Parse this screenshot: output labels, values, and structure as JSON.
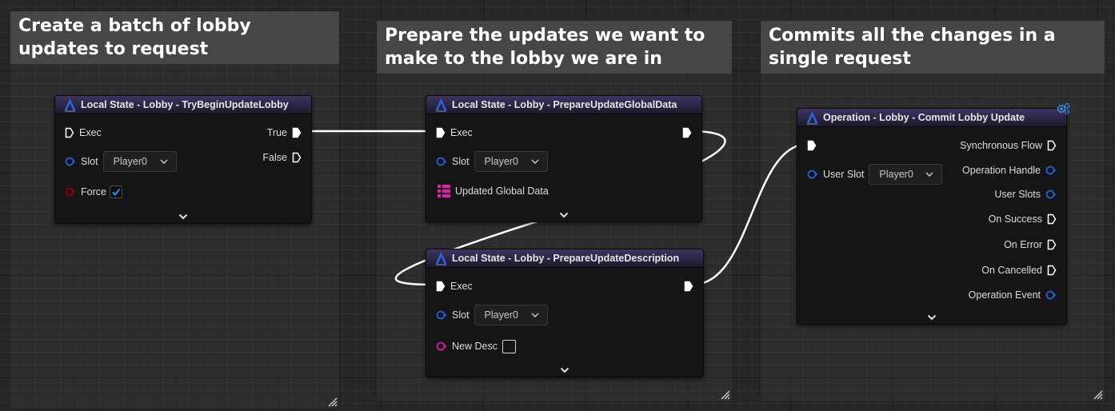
{
  "comments": [
    {
      "title": "Create a batch of lobby updates to request"
    },
    {
      "title": "Prepare the updates we want to make to the lobby we are in"
    },
    {
      "title": "Commits all the changes in a single request"
    }
  ],
  "colors": {
    "exec_pin": "#ffffff",
    "struct_pin": "#1e63d6",
    "bool_pin": "#8c0000",
    "string_pin": "#d81ca8",
    "map_pin": "#e21caf",
    "node_header": "#3b3160",
    "check_mark": "#2f8ff0"
  },
  "icons": {
    "node_icon": "redpoint-eos-logo-icon",
    "latent": "gear-cluster-icon"
  },
  "nodes": {
    "try_begin": {
      "title": "Local State - Lobby - TryBeginUpdateLobby",
      "exec_in": "Exec",
      "slot_label": "Slot",
      "slot_value": "Player0",
      "force_label": "Force",
      "force_checked": true,
      "true_label": "True",
      "false_label": "False"
    },
    "global_data": {
      "title": "Local State - Lobby - PrepareUpdateGlobalData",
      "exec_in": "Exec",
      "slot_label": "Slot",
      "slot_value": "Player0",
      "data_label": "Updated Global Data"
    },
    "description": {
      "title": "Local State - Lobby - PrepareUpdateDescription",
      "exec_in": "Exec",
      "slot_label": "Slot",
      "slot_value": "Player0",
      "desc_label": "New Desc",
      "desc_checked": false
    },
    "commit": {
      "title": "Operation - Lobby - Commit Lobby Update",
      "user_slot_label": "User Slot",
      "user_slot_value": "Player0",
      "outputs": [
        "Synchronous Flow",
        "Operation Handle",
        "User Slots",
        "On Success",
        "On Error",
        "On Cancelled",
        "Operation Event"
      ]
    }
  }
}
